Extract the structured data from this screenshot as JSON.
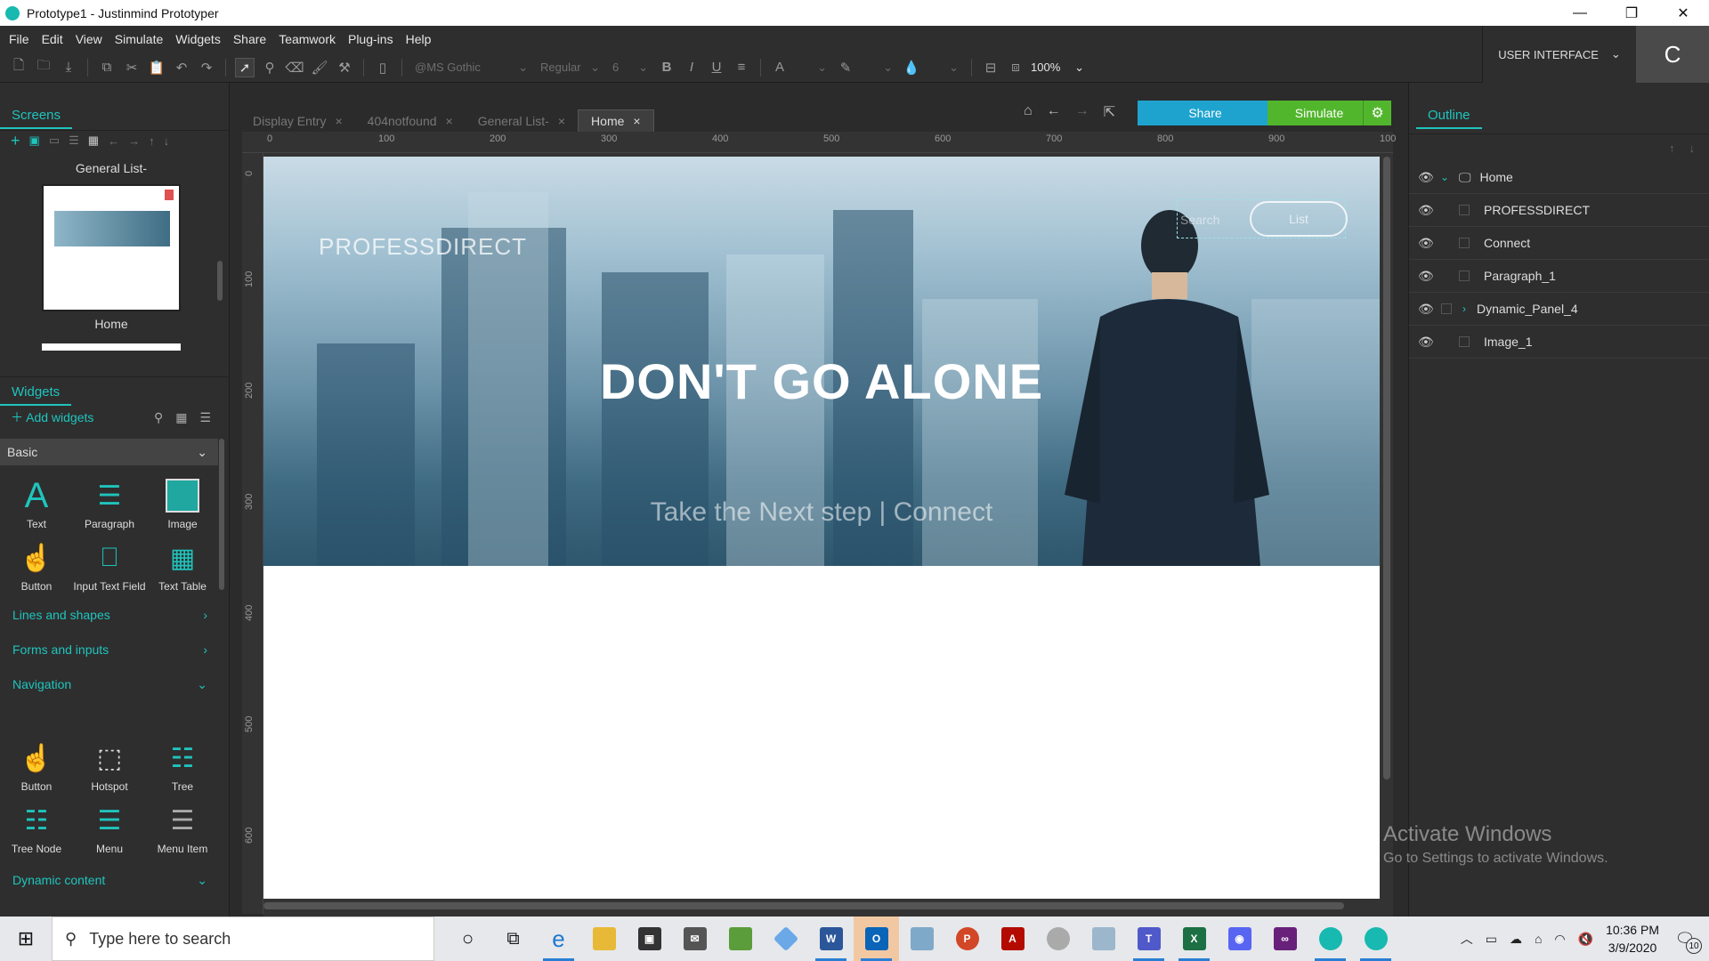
{
  "window": {
    "title": "Prototype1 - Justinmind Prototyper",
    "minimize": "—",
    "maximize": "❐",
    "close": "✕"
  },
  "menu": [
    "File",
    "Edit",
    "View",
    "Simulate",
    "Widgets",
    "Share",
    "Teamwork",
    "Plug-ins",
    "Help"
  ],
  "toolbar": {
    "font": "@MS Gothic",
    "style": "Regular",
    "size": "6",
    "bold": "B",
    "italic": "I",
    "underline": "U",
    "font_color": "A",
    "zoom": "100%"
  },
  "mode": {
    "label": "USER INTERFACE"
  },
  "user": {
    "initial": "C"
  },
  "screens": {
    "tab": "Screens",
    "group_label": "General List-",
    "items": [
      {
        "label": "Home"
      }
    ]
  },
  "widgets": {
    "tab": "Widgets",
    "add": "Add widgets",
    "basic_label": "Basic",
    "basic": [
      "Text",
      "Paragraph",
      "Image",
      "Button",
      "Input Text Field",
      "Text Table"
    ],
    "categories": [
      "Lines and shapes",
      "Forms and inputs",
      "Navigation"
    ],
    "navigation": [
      "Button",
      "Hotspot",
      "Tree",
      "Tree Node",
      "Menu",
      "Menu Item"
    ],
    "dynamic": "Dynamic content"
  },
  "doc_tabs": [
    {
      "label": "Display Entry",
      "active": false
    },
    {
      "label": "404notfound",
      "active": false
    },
    {
      "label": "General List-",
      "active": false
    },
    {
      "label": "Home",
      "active": true
    }
  ],
  "actions": {
    "share": "Share",
    "simulate": "Simulate"
  },
  "ruler": {
    "top": [
      "0",
      "100",
      "200",
      "300",
      "400",
      "500",
      "600",
      "700",
      "800",
      "900",
      "100"
    ],
    "left": [
      "0",
      "100",
      "200",
      "300",
      "400",
      "500",
      "600"
    ]
  },
  "hero": {
    "brand": "PROFESSDIRECT",
    "title": "DON'T GO ALONE",
    "subtitle": "Take the Next step | Connect",
    "search": "Search",
    "list": "List"
  },
  "outline": {
    "tab": "Outline",
    "items": [
      {
        "label": "Home",
        "expander": "⌄"
      },
      {
        "label": "PROFESSDIRECT",
        "expander": ""
      },
      {
        "label": "Connect",
        "expander": ""
      },
      {
        "label": "Paragraph_1",
        "expander": ""
      },
      {
        "label": "Dynamic_Panel_4",
        "expander": "›"
      },
      {
        "label": "Image_1",
        "expander": ""
      }
    ]
  },
  "watermark": {
    "line1": "Activate Windows",
    "line2": "Go to Settings to activate Windows."
  },
  "taskbar": {
    "search_placeholder": "Type here to search",
    "time": "10:36 PM",
    "date": "3/9/2020",
    "notifications": "10"
  },
  "colors": {
    "accent": "#1fc4bd",
    "share": "#1ea3cf",
    "simulate": "#52b62d"
  }
}
